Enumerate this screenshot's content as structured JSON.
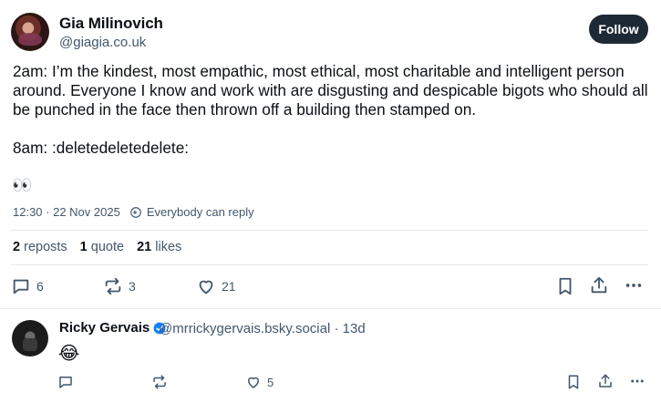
{
  "post": {
    "author_name": "Gia Milinovich",
    "author_handle": "@giagia.co.uk",
    "follow_label": "Follow",
    "text_line1": "2am: I’m the kindest, most empathic, most ethical, most charitable and intelligent person",
    "text_line2": "around. Everyone I know and work with are disgusting and despicable bigots who should all",
    "text_line3": "be punched in the face then thrown off a building then stamped on.",
    "text_line4": "8am: :deletedeletedelete:",
    "emoji": "👀",
    "timestamp": "12:30 · 22 Nov 2025",
    "reply_setting": "Everybody can reply",
    "stats": {
      "reposts_count": "2",
      "reposts_label": "reposts",
      "quotes_count": "1",
      "quotes_label": "quote",
      "likes_count": "21",
      "likes_label": "likes"
    },
    "actions": {
      "reply_count": "6",
      "repost_count": "3",
      "like_count": "21"
    }
  },
  "reply": {
    "author_name": "Ricky Gervais",
    "author_handle_time": "@mrrickygervais.bsky.social · 13d",
    "text": "😂",
    "like_count": "5"
  },
  "colors": {
    "text_primary": "#0b0f14",
    "text_secondary": "#42576c",
    "follow_bg": "#1e2936",
    "verified": "#1083fe",
    "divider": "#e3e7ec"
  },
  "icons": [
    "reply-icon",
    "repost-icon",
    "like-icon",
    "bookmark-icon",
    "share-icon",
    "more-icon",
    "verified-icon",
    "everybody-reply-icon"
  ]
}
